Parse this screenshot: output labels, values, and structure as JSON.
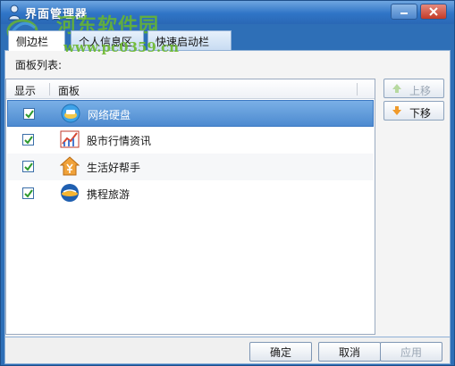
{
  "window": {
    "title": "界面管理器",
    "watermark_text": "河东软件园",
    "watermark_url": "www.pc0359.cn",
    "controls": {
      "minimize_icon": "minimize-icon",
      "close_icon": "close-icon"
    }
  },
  "tabs": [
    {
      "label": "侧边栏",
      "active": true
    },
    {
      "label": "个人信息区",
      "active": false
    },
    {
      "label": "快速启动栏",
      "active": false
    }
  ],
  "panel": {
    "list_label": "面板列表:",
    "columns": {
      "show": "显示",
      "panel": "面板"
    },
    "rows": [
      {
        "label": "网络硬盘",
        "checked": true,
        "icon": "cloud-disk-icon",
        "selected": true
      },
      {
        "label": "股市行情资讯",
        "checked": true,
        "icon": "stock-chart-icon",
        "selected": false
      },
      {
        "label": "生活好帮手",
        "checked": true,
        "icon": "yuan-house-icon",
        "selected": false
      },
      {
        "label": "携程旅游",
        "checked": true,
        "icon": "travel-plane-icon",
        "selected": false
      }
    ]
  },
  "side_buttons": {
    "move_up": "上移",
    "move_down": "下移"
  },
  "footer": {
    "ok": "确定",
    "cancel": "取消",
    "apply": "应用"
  },
  "colors": {
    "titlebar": "#2f74c6",
    "selection": "#4d8ad0",
    "watermark": "#6bb82b",
    "tab_border": "#8fb0d6"
  }
}
